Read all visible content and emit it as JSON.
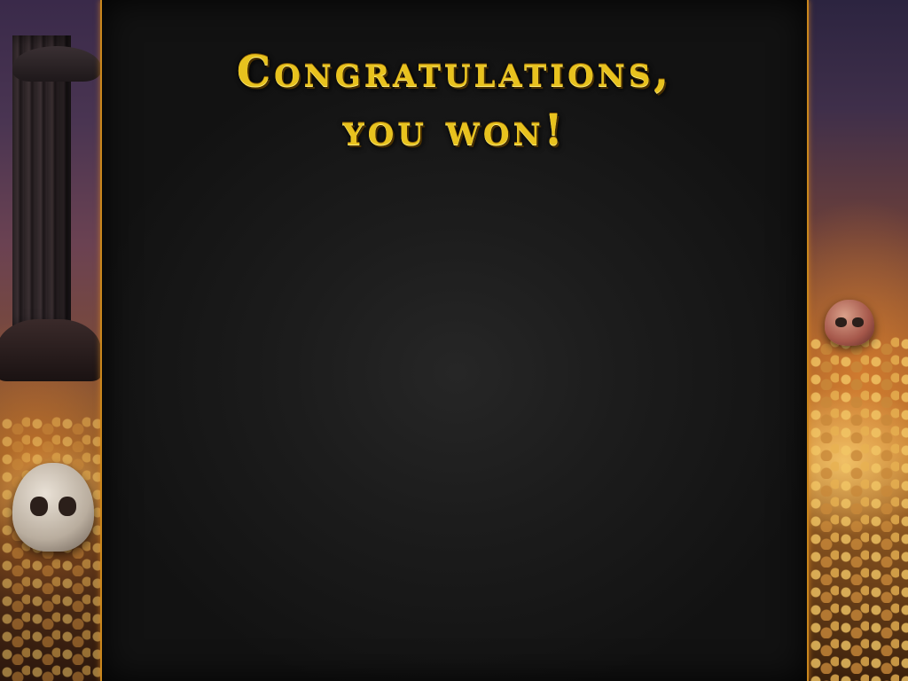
{
  "screen": {
    "title_line1": "Congratulations,",
    "title_line2": "you won!"
  },
  "colors": {
    "title_gold": "#e8c21e",
    "panel_border": "#c9861d",
    "panel_bg": "#1c1c1c"
  }
}
